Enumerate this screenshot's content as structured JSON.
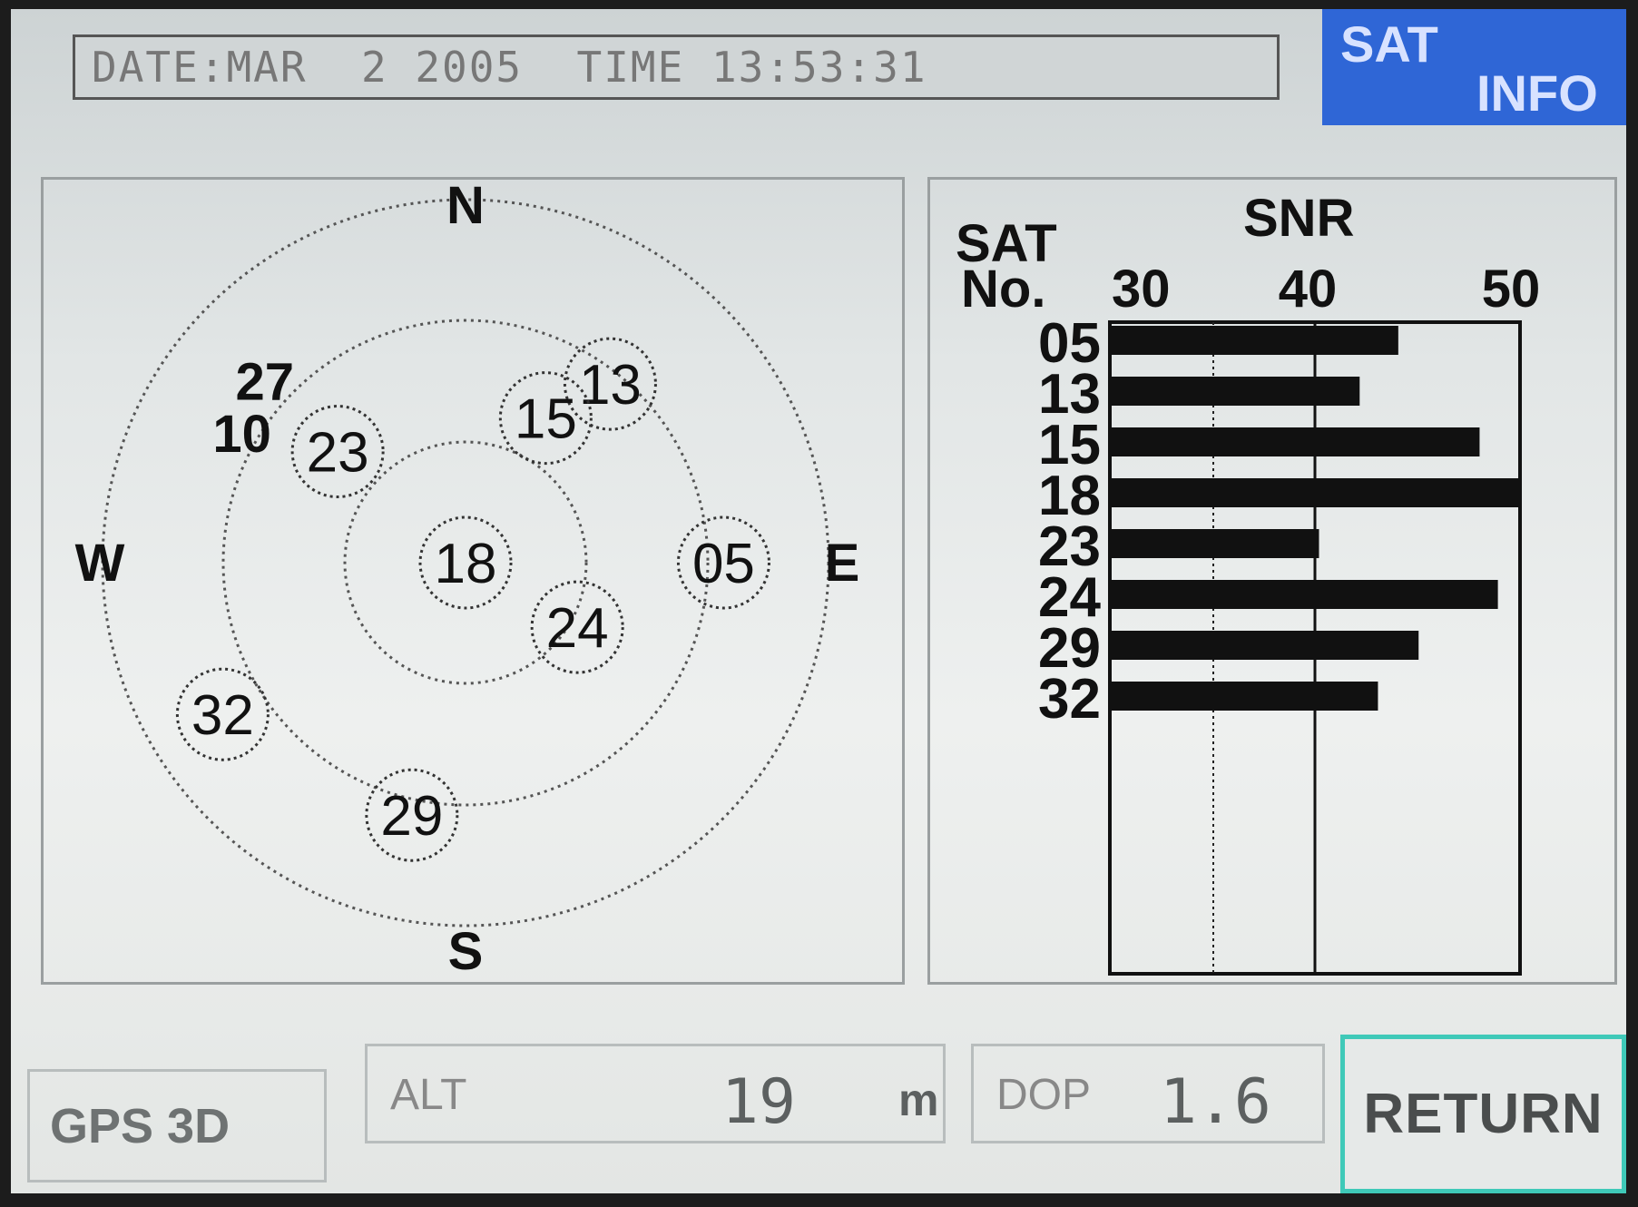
{
  "header": {
    "datetime": "DATE:MAR  2 2005  TIME 13:53:31",
    "title_line1": "SAT",
    "title_line2": "INFO"
  },
  "skyplot": {
    "compass": {
      "north": "N",
      "south": "S",
      "east": "E",
      "west": "W"
    },
    "tracked_satellites": [
      {
        "id": "13",
        "azimuth_deg": 39,
        "elevation_deg": 33
      },
      {
        "id": "23",
        "azimuth_deg": 311,
        "elevation_deg": 48
      },
      {
        "id": "15",
        "azimuth_deg": 29,
        "elevation_deg": 49
      },
      {
        "id": "18",
        "azimuth_deg": 0,
        "elevation_deg": 90
      },
      {
        "id": "24",
        "azimuth_deg": 120,
        "elevation_deg": 58
      },
      {
        "id": "05",
        "azimuth_deg": 90,
        "elevation_deg": 26
      },
      {
        "id": "32",
        "azimuth_deg": 238,
        "elevation_deg": 19
      },
      {
        "id": "29",
        "azimuth_deg": 192,
        "elevation_deg": 26
      }
    ],
    "untracked_satellites": [
      {
        "id": "27",
        "azimuth_deg": 312,
        "elevation_deg": 23
      },
      {
        "id": "10",
        "azimuth_deg": 300,
        "elevation_deg": 26
      }
    ]
  },
  "snr_panel": {
    "header_sat": "SAT",
    "header_no": "No.",
    "header_snr": "SNR",
    "ticks": [
      "30",
      "40",
      "50"
    ]
  },
  "chart_data": {
    "type": "bar",
    "orientation": "horizontal",
    "title": "SNR",
    "categories": [
      "05",
      "13",
      "15",
      "18",
      "23",
      "24",
      "29",
      "32"
    ],
    "values": [
      44.1,
      42.2,
      48.1,
      50,
      40.2,
      49,
      45.1,
      43.1
    ],
    "xlim": [
      30,
      50
    ],
    "ticks": [
      30,
      40,
      50
    ],
    "grid": true
  },
  "status": {
    "fix": "GPS 3D",
    "alt_label": "ALT",
    "alt_value": "19",
    "alt_unit": "m",
    "dop_label": "DOP",
    "dop_value": "1.6"
  },
  "return_label": "RETURN"
}
